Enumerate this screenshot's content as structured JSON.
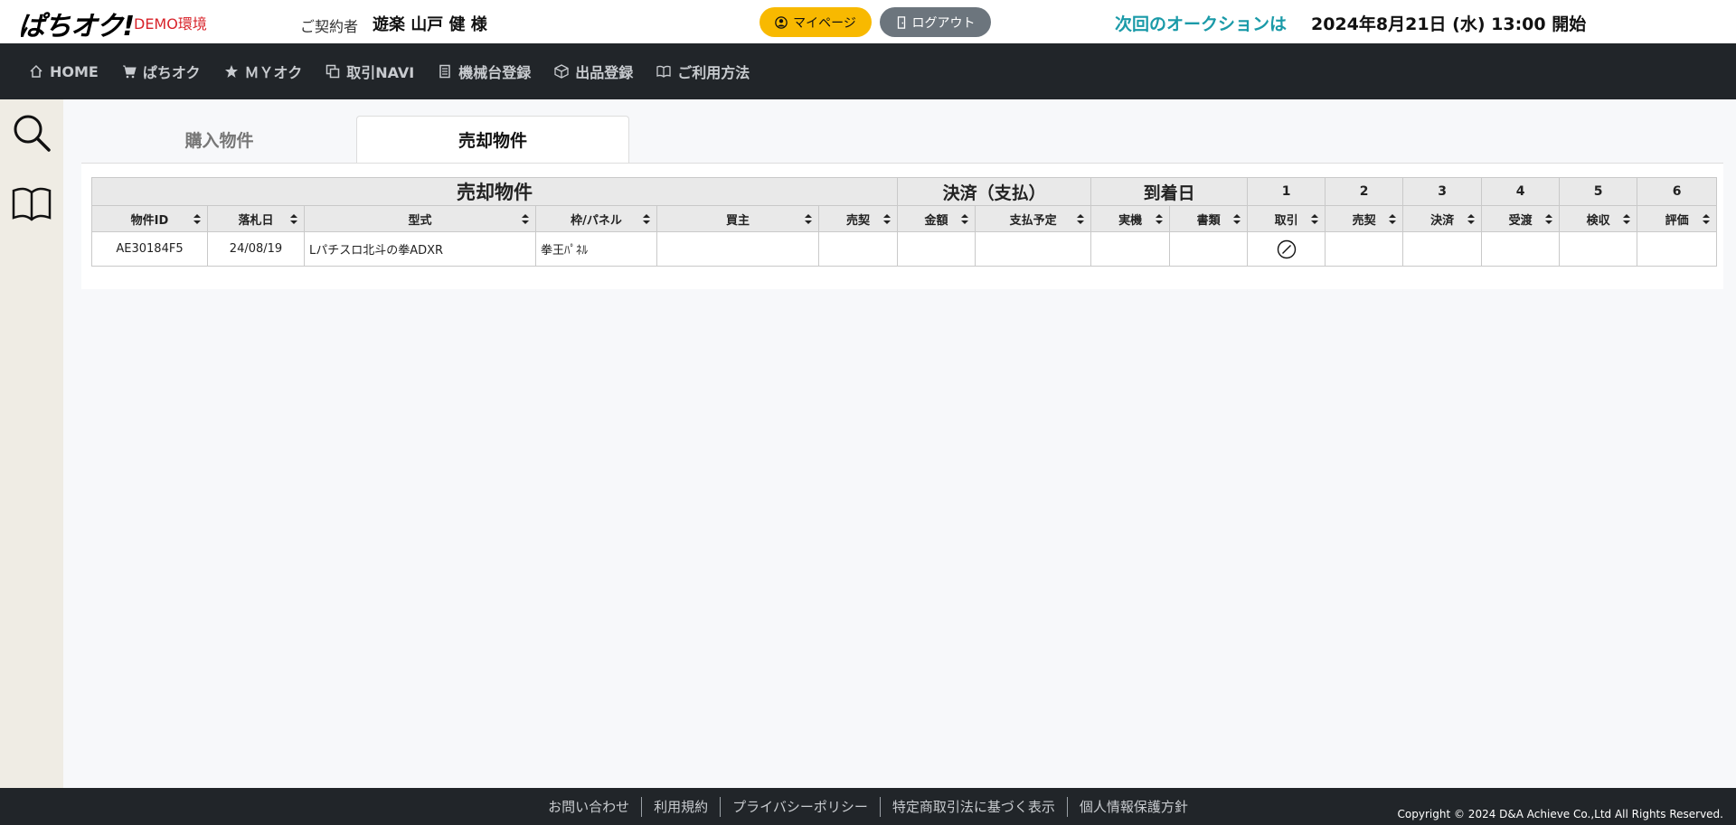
{
  "header": {
    "logo": "ぱちオク!",
    "env_badge": "DEMO環境",
    "contract_label": "ご契約者",
    "contract_name": "遊楽 山戸 健 様",
    "mypage_label": "マイページ",
    "logout_label": "ログアウト",
    "next_auction_label": "次回のオークションは",
    "next_auction_date": "2024年8月21日 (水) 13:00 開始"
  },
  "nav": {
    "items": [
      {
        "label": "HOME",
        "icon": "home-icon"
      },
      {
        "label": "ぱちオク",
        "icon": "cart-icon"
      },
      {
        "label": "ＭＹオク",
        "icon": "star-icon"
      },
      {
        "label": "取引NAVI",
        "icon": "copy-icon"
      },
      {
        "label": "機械台登録",
        "icon": "list-icon"
      },
      {
        "label": "出品登録",
        "icon": "box-icon"
      },
      {
        "label": "ご利用方法",
        "icon": "book-icon"
      }
    ]
  },
  "sidebar": {
    "items": [
      {
        "icon": "search-icon"
      },
      {
        "icon": "book-icon"
      }
    ]
  },
  "tabs": [
    {
      "label": "購入物件",
      "active": false
    },
    {
      "label": "売却物件",
      "active": true
    }
  ],
  "table": {
    "groups": {
      "main": "売却物件",
      "payment": "決済（支払）",
      "arrival": "到着日",
      "step1": "1",
      "step2": "2",
      "step3": "3",
      "step4": "4",
      "step5": "5",
      "step6": "6"
    },
    "columns": [
      "物件ID",
      "落札日",
      "型式",
      "枠/パネル",
      "買主",
      "売契",
      "金額",
      "支払予定",
      "実機",
      "書類",
      "取引",
      "売契",
      "決済",
      "受渡",
      "検収",
      "評価"
    ],
    "rows": [
      {
        "id": "AE30184F5",
        "date": "24/08/19",
        "model": "Lパチスロ北斗の拳ADXR",
        "panel": "拳王ﾊﾟﾈﾙ",
        "buyer": "",
        "contract": "",
        "amount": "",
        "pay_schedule": "",
        "machine": "",
        "docs": "",
        "deal_status_icon": "disabled-circle-icon"
      }
    ]
  },
  "footer": {
    "links": [
      "お問い合わせ",
      "利用規約",
      "プライバシーポリシー",
      "特定商取引法に基づく表示",
      "個人情報保護方針"
    ],
    "copyright": "Copyright © 2024 D&A Achieve Co.,Ltd All Rights Reserved."
  },
  "colors": {
    "accent_yellow": "#f8b900",
    "accent_teal": "#1a9aa8",
    "demo_red": "#d8232a",
    "nav_bg": "#212529"
  }
}
